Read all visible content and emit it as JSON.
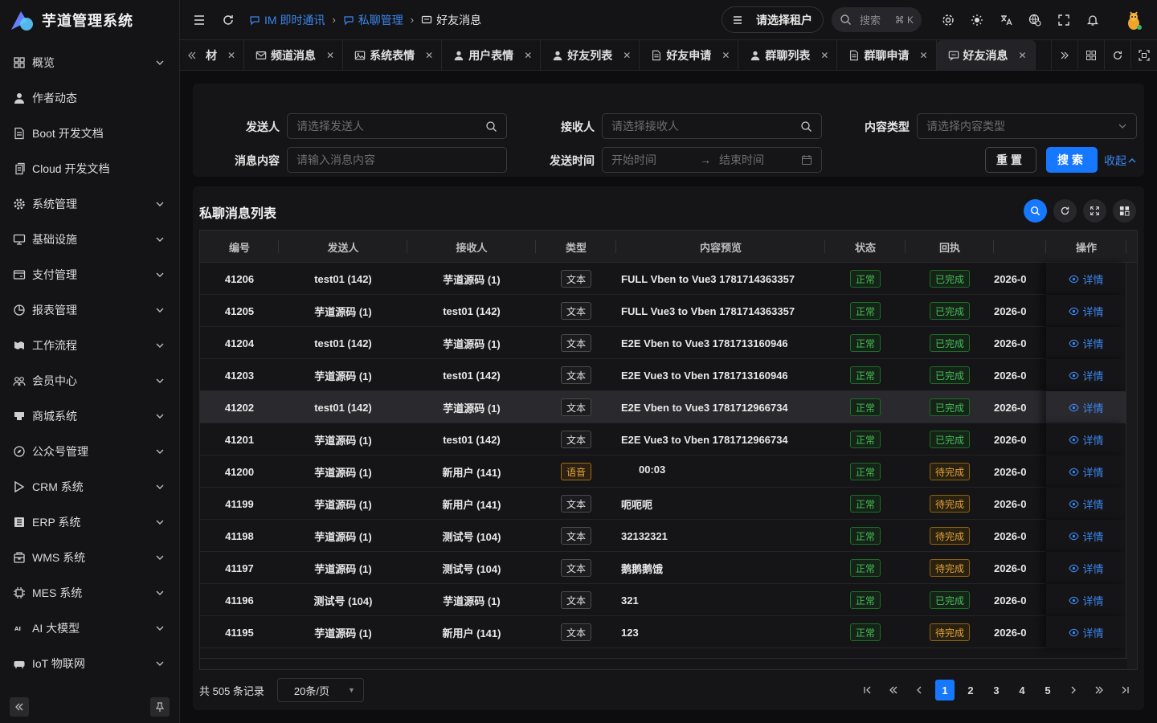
{
  "app": {
    "title": "芋道管理系统"
  },
  "sidebar": {
    "items": [
      {
        "label": "概览",
        "icon": "grid-icon",
        "chev": true
      },
      {
        "label": "作者动态",
        "icon": "user-icon",
        "chev": false
      },
      {
        "label": "Boot 开发文档",
        "icon": "doc-icon",
        "chev": false
      },
      {
        "label": "Cloud 开发文档",
        "icon": "doc-copy-icon",
        "chev": false
      },
      {
        "label": "系统管理",
        "icon": "gear-icon",
        "chev": true
      },
      {
        "label": "基础设施",
        "icon": "monitor-icon",
        "chev": true
      },
      {
        "label": "支付管理",
        "icon": "wallet-icon",
        "chev": true
      },
      {
        "label": "报表管理",
        "icon": "pie-icon",
        "chev": true
      },
      {
        "label": "工作流程",
        "icon": "flow-icon",
        "chev": true
      },
      {
        "label": "会员中心",
        "icon": "members-icon",
        "chev": true
      },
      {
        "label": "商城系统",
        "icon": "shop-icon",
        "chev": true
      },
      {
        "label": "公众号管理",
        "icon": "compass-icon",
        "chev": true
      },
      {
        "label": "CRM 系统",
        "icon": "crm-icon",
        "chev": true
      },
      {
        "label": "ERP 系统",
        "icon": "erp-icon",
        "chev": true
      },
      {
        "label": "WMS 系统",
        "icon": "warehouse-icon",
        "chev": true
      },
      {
        "label": "MES 系统",
        "icon": "chip-icon",
        "chev": true
      },
      {
        "label": "AI 大模型",
        "icon": "ai-icon",
        "chev": true
      },
      {
        "label": "IoT 物联网",
        "icon": "iot-icon",
        "chev": true
      }
    ]
  },
  "header": {
    "breadcrumbs": [
      {
        "label": "IM 即时通讯",
        "type": "link"
      },
      {
        "label": "私聊管理",
        "type": "link"
      },
      {
        "label": "好友消息",
        "type": "current"
      }
    ],
    "tenant": "请选择租户",
    "search_placeholder": "搜索",
    "search_kbd": "⌘ K"
  },
  "tabs": [
    {
      "label": "材",
      "icon": "",
      "active": false
    },
    {
      "label": "频道消息",
      "icon": "mail-icon",
      "active": false
    },
    {
      "label": "系统表情",
      "icon": "image-icon",
      "active": false
    },
    {
      "label": "用户表情",
      "icon": "user-icon",
      "active": false
    },
    {
      "label": "好友列表",
      "icon": "user-icon",
      "active": false
    },
    {
      "label": "好友申请",
      "icon": "doc-icon",
      "active": false
    },
    {
      "label": "群聊列表",
      "icon": "user-solid-icon",
      "active": false
    },
    {
      "label": "群聊申请",
      "icon": "doc-icon",
      "active": false
    },
    {
      "label": "好友消息",
      "icon": "chat-icon",
      "active": true
    }
  ],
  "filter": {
    "sender_label": "发送人",
    "sender_placeholder": "请选择发送人",
    "receiver_label": "接收人",
    "receiver_placeholder": "请选择接收人",
    "type_label": "内容类型",
    "type_placeholder": "请选择内容类型",
    "content_label": "消息内容",
    "content_placeholder": "请输入消息内容",
    "time_label": "发送时间",
    "time_start": "开始时间",
    "time_end": "结束时间",
    "reset": "重置",
    "search": "搜索",
    "collapse": "收起"
  },
  "table": {
    "title": "私聊消息列表",
    "columns": [
      "编号",
      "发送人",
      "接收人",
      "类型",
      "内容预览",
      "状态",
      "回执",
      "",
      "操作"
    ],
    "rows": [
      {
        "id": "41206",
        "sender": "test01 (142)",
        "receiver": "芋道源码 (1)",
        "type": "文本",
        "content": "FULL Vben to Vue3 1781714363357",
        "status": "正常",
        "receipt": "已完成",
        "time": "2026-0",
        "op": "详情"
      },
      {
        "id": "41205",
        "sender": "芋道源码 (1)",
        "receiver": "test01 (142)",
        "type": "文本",
        "content": "FULL Vue3 to Vben 1781714363357",
        "status": "正常",
        "receipt": "已完成",
        "time": "2026-0",
        "op": "详情"
      },
      {
        "id": "41204",
        "sender": "test01 (142)",
        "receiver": "芋道源码 (1)",
        "type": "文本",
        "content": "E2E Vben to Vue3 1781713160946",
        "status": "正常",
        "receipt": "已完成",
        "time": "2026-0",
        "op": "详情"
      },
      {
        "id": "41203",
        "sender": "芋道源码 (1)",
        "receiver": "test01 (142)",
        "type": "文本",
        "content": "E2E Vue3 to Vben 1781713160946",
        "status": "正常",
        "receipt": "已完成",
        "time": "2026-0",
        "op": "详情"
      },
      {
        "id": "41202",
        "sender": "test01 (142)",
        "receiver": "芋道源码 (1)",
        "type": "文本",
        "content": "E2E Vben to Vue3 1781712966734",
        "status": "正常",
        "receipt": "已完成",
        "time": "2026-0",
        "op": "详情",
        "highlight": true
      },
      {
        "id": "41201",
        "sender": "芋道源码 (1)",
        "receiver": "test01 (142)",
        "type": "文本",
        "content": "E2E Vue3 to Vben 1781712966734",
        "status": "正常",
        "receipt": "已完成",
        "time": "2026-0",
        "op": "详情"
      },
      {
        "id": "41200",
        "sender": "芋道源码 (1)",
        "receiver": "新用户 (141)",
        "type": "语音",
        "content": "00:03",
        "status": "正常",
        "receipt": "待完成",
        "time": "2026-0",
        "op": "详情"
      },
      {
        "id": "41199",
        "sender": "芋道源码 (1)",
        "receiver": "新用户 (141)",
        "type": "文本",
        "content": "呃呃呃",
        "status": "正常",
        "receipt": "待完成",
        "time": "2026-0",
        "op": "详情"
      },
      {
        "id": "41198",
        "sender": "芋道源码 (1)",
        "receiver": "测试号 (104)",
        "type": "文本",
        "content": "32132321",
        "status": "正常",
        "receipt": "待完成",
        "time": "2026-0",
        "op": "详情"
      },
      {
        "id": "41197",
        "sender": "芋道源码 (1)",
        "receiver": "测试号 (104)",
        "type": "文本",
        "content": "鹅鹅鹅饿",
        "status": "正常",
        "receipt": "待完成",
        "time": "2026-0",
        "op": "详情"
      },
      {
        "id": "41196",
        "sender": "测试号 (104)",
        "receiver": "芋道源码 (1)",
        "type": "文本",
        "content": "321",
        "status": "正常",
        "receipt": "已完成",
        "time": "2026-0",
        "op": "详情"
      },
      {
        "id": "41195",
        "sender": "芋道源码 (1)",
        "receiver": "新用户 (141)",
        "type": "文本",
        "content": "123",
        "status": "正常",
        "receipt": "待完成",
        "time": "2026-0",
        "op": "详情"
      }
    ]
  },
  "pagination": {
    "total": "共 505 条记录",
    "page_size": "20条/页",
    "pages": [
      "1",
      "2",
      "3",
      "4",
      "5"
    ],
    "current": "1"
  }
}
